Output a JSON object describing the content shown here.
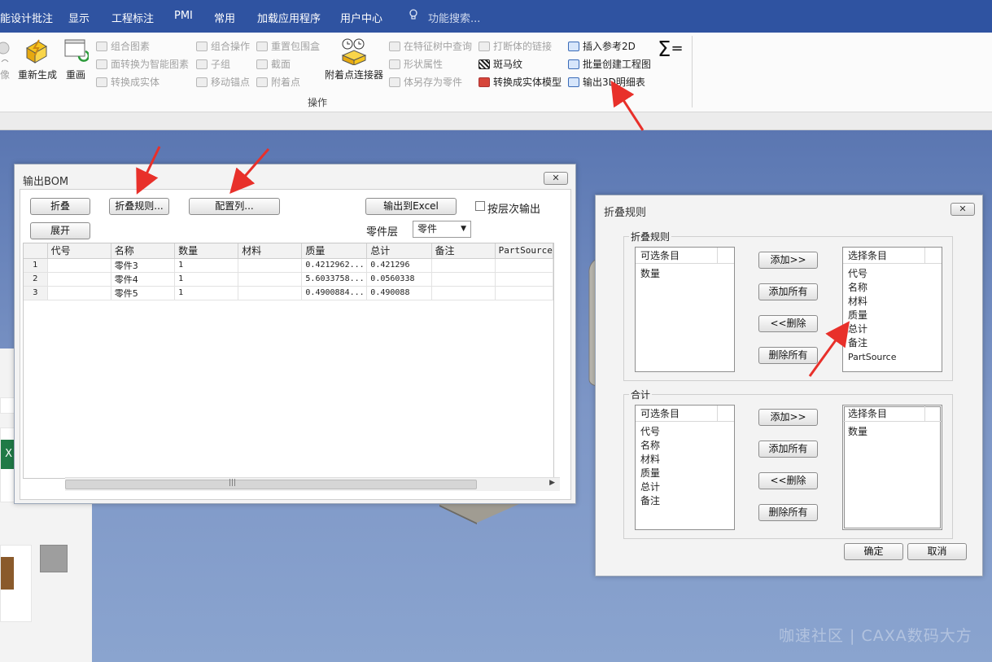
{
  "menubar": {
    "items": [
      "能设计批注",
      "显示",
      "工程标注",
      "PMI",
      "常用",
      "加载应用程序",
      "用户中心"
    ],
    "search_placeholder": "功能搜索..."
  },
  "ribbon": {
    "big_buttons": [
      "像",
      "重新生成",
      "重画",
      "附着点连接器"
    ],
    "col1": [
      "组合图素",
      "面转换为智能图素",
      "转换成实体"
    ],
    "col2": [
      "组合操作",
      "子组",
      "移动锚点"
    ],
    "col3": [
      "重置包围盒",
      "截面",
      "附着点"
    ],
    "col4": [
      "在特征树中查询",
      "形状属性",
      "体另存为零件"
    ],
    "col5": [
      "打断体的链接",
      "斑马纹",
      "转换成实体模型"
    ],
    "col6": [
      "插入参考2D",
      "批量创建工程图",
      "输出3D明细表"
    ],
    "group_label": "操作"
  },
  "bom_dialog": {
    "title": "输出BOM",
    "buttons": {
      "fold": "折叠",
      "fold_rule": "折叠规则...",
      "config_cols": "配置列...",
      "export_excel": "输出到Excel",
      "expand": "展开"
    },
    "hier_output_label": "按层次输出",
    "level_label": "零件层",
    "level_value": "零件",
    "columns": [
      "代号",
      "名称",
      "数量",
      "材料",
      "质量",
      "总计",
      "备注",
      "PartSource"
    ],
    "rows": [
      {
        "n": "1",
        "code": "",
        "name": "零件3",
        "qty": "1",
        "material": "",
        "mass": "0.4212962...",
        "total": "0.421296",
        "note": "",
        "src": ""
      },
      {
        "n": "2",
        "code": "",
        "name": "零件4",
        "qty": "1",
        "material": "",
        "mass": "5.6033758...",
        "total": "0.0560338",
        "note": "",
        "src": ""
      },
      {
        "n": "3",
        "code": "",
        "name": "零件5",
        "qty": "1",
        "material": "",
        "mass": "0.4900884...",
        "total": "0.490088",
        "note": "",
        "src": ""
      }
    ]
  },
  "fold_dialog": {
    "title": "折叠规则",
    "group1": {
      "legend": "折叠规则",
      "available_header": "可选条目",
      "available": [
        "数量"
      ],
      "selected_header": "选择条目",
      "selected": [
        "代号",
        "名称",
        "材料",
        "质量",
        "总计",
        "备注",
        "PartSource"
      ]
    },
    "group2": {
      "legend": "合计",
      "available_header": "可选条目",
      "available": [
        "代号",
        "名称",
        "材料",
        "质量",
        "总计",
        "备注"
      ],
      "selected_header": "选择条目",
      "selected": [
        "数量"
      ]
    },
    "buttons": {
      "add": "添加>>",
      "add_all": "添加所有",
      "remove": "<<删除",
      "remove_all": "删除所有",
      "ok": "确定",
      "cancel": "取消"
    }
  },
  "explorer": {
    "more": "..."
  },
  "watermark": "咖速社区 | CAXA数码大方",
  "colors": {
    "menubar": "#2f53a1",
    "annotation_arrow": "#e8302a",
    "viewport": "#6e88bd"
  }
}
